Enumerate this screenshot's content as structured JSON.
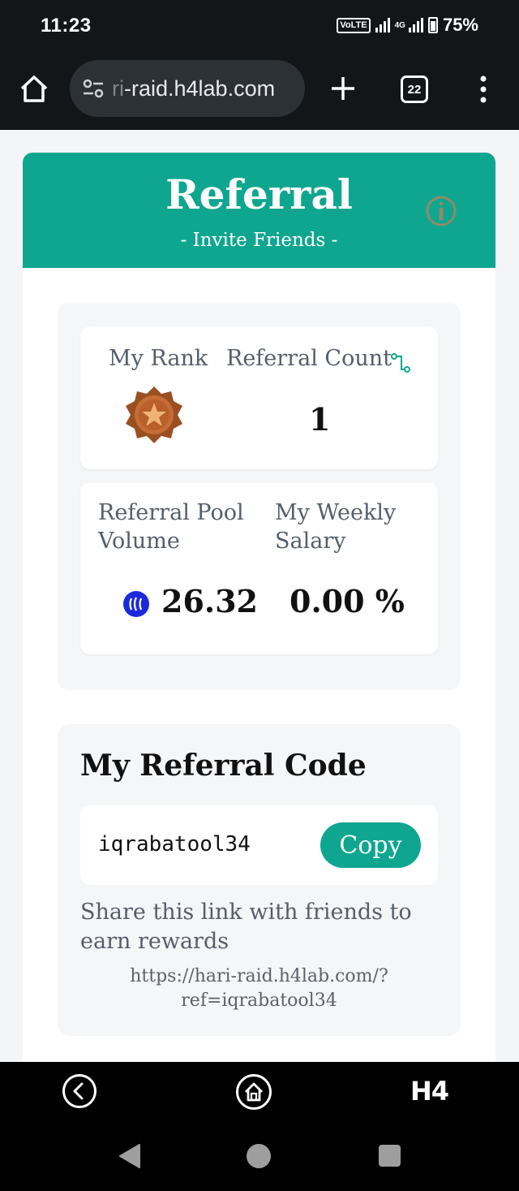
{
  "status_bar": {
    "time": "11:23",
    "volte": "VoLTE",
    "network": "4G",
    "battery": "75%"
  },
  "browser": {
    "url_fade": "ri",
    "url_main": "-raid.h4lab.com",
    "tab_count": "22"
  },
  "header": {
    "title": "Referral",
    "subtitle": "- Invite Friends -"
  },
  "stats": {
    "rank_label": "My Rank",
    "rank_icon": "bronze-medal-icon",
    "referral_count_label": "Referral Count",
    "referral_count_value": "1",
    "pool_label_line1": "Referral Pool",
    "pool_label_line2": "Volume",
    "pool_value": "26.32",
    "salary_label_line1": "My Weekly",
    "salary_label_line2": "Salary",
    "salary_value": "0.00 %"
  },
  "referral_code": {
    "title": "My Referral Code",
    "code": "iqrabatool34",
    "copy_label": "Copy",
    "share_text": "Share this link with friends to earn rewards",
    "link_line1": "https://hari-raid.h4lab.com/?",
    "link_line2": "ref=iqrabatool34"
  },
  "web_nav": {
    "logo": "H4"
  },
  "colors": {
    "accent": "#0fa68f",
    "steem_blue": "#1a2ad8",
    "medal_bronze": "#b8652f"
  }
}
